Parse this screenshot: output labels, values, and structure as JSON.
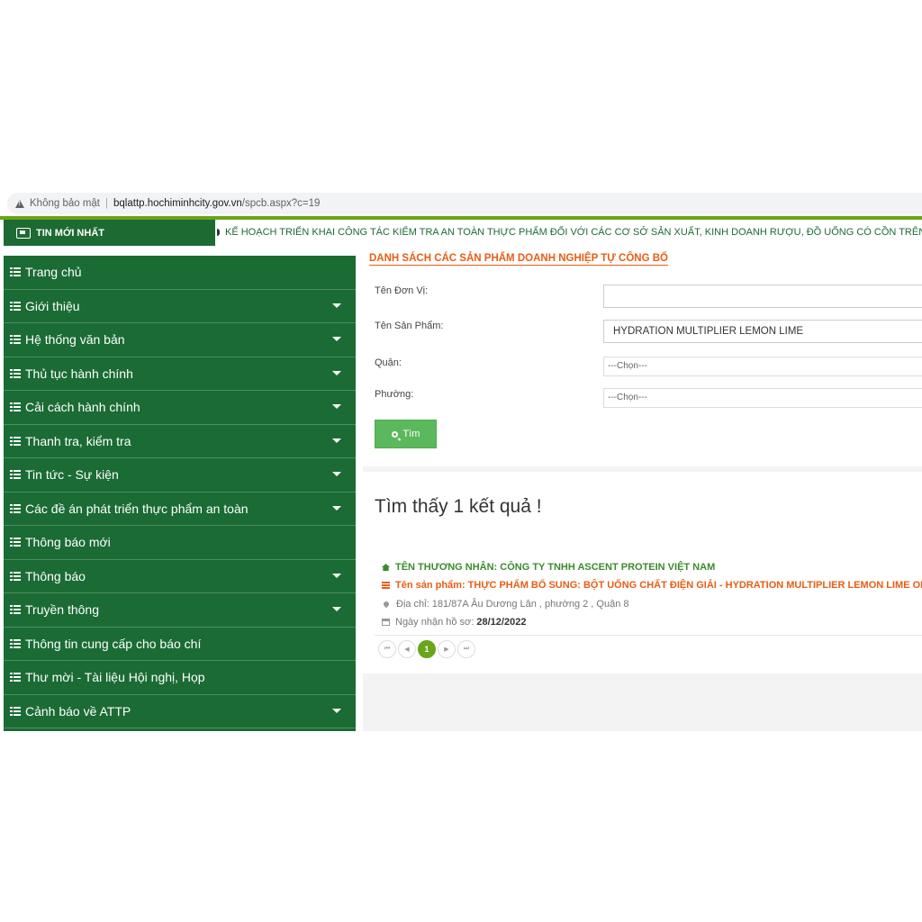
{
  "browser": {
    "security_label": "Không bảo mật",
    "url_host": "bqlattp.hochiminhcity.gov.vn",
    "url_path": "/spcb.aspx?c=19"
  },
  "ticker": {
    "label": "TIN MỚI NHẤT",
    "text": "KẾ HOẠCH TRIỂN KHAI CÔNG TÁC KIỂM TRA AN TOÀN THỰC PHẨM ĐỐI VỚI CÁC CƠ SỞ SẢN XUẤT, KINH DOANH RƯỢU, ĐỒ UỐNG CÓ CỒN TRÊN ĐỊA BÀN T"
  },
  "sidebar": {
    "items": [
      {
        "label": "Trang chủ",
        "has_caret": false
      },
      {
        "label": "Giới thiệu",
        "has_caret": true
      },
      {
        "label": "Hệ thống văn bản",
        "has_caret": true
      },
      {
        "label": "Thủ tục hành chính",
        "has_caret": true
      },
      {
        "label": "Cải cách hành chính",
        "has_caret": true
      },
      {
        "label": "Thanh tra, kiểm tra",
        "has_caret": true
      },
      {
        "label": "Tin tức - Sự kiện",
        "has_caret": true
      },
      {
        "label": "Các đề án phát triển thực phẩm an toàn",
        "has_caret": true
      },
      {
        "label": "Thông báo mới",
        "has_caret": false
      },
      {
        "label": "Thông báo",
        "has_caret": true
      },
      {
        "label": "Truyền thông",
        "has_caret": true
      },
      {
        "label": "Thông tin cung cấp cho báo chí",
        "has_caret": false
      },
      {
        "label": "Thư mời - Tài liệu Hội nghị, Họp",
        "has_caret": false
      },
      {
        "label": "Cảnh báo về ATTP",
        "has_caret": true
      }
    ]
  },
  "search": {
    "title": "DANH SÁCH CÁC SẢN PHẨM DOANH NGHIỆP TỰ CÔNG BỐ",
    "unit_label": "Tên Đơn Vị:",
    "unit_value": "",
    "product_label": "Tên Sản Phẩm:",
    "product_value": "HYDRATION MULTIPLIER LEMON LIME",
    "district_label": "Quận:",
    "district_value": "---Chọn---",
    "ward_label": "Phường:",
    "ward_value": "---Chọn---",
    "search_button": "Tìm"
  },
  "results": {
    "heading": "Tìm thấy 1 kết quả !",
    "items": [
      {
        "merchant": "TÊN THƯƠNG NHÂN: CÔNG TY TNHH ASCENT PROTEIN VIỆT NAM",
        "product": "Tên sản phẩm: THỰC PHẨM BỔ SUNG: BỘT UỐNG CHẤT ĐIỆN GIẢI - HYDRATION MULTIPLIER LEMON LIME ONE-TIME",
        "address": "Địa chỉ: 181/87A Âu Dương Lân , phường 2 , Quận 8",
        "date_label": "Ngày nhận hồ sơ:",
        "date_value": "28/12/2022"
      }
    ],
    "pager": {
      "first": "⏮",
      "prev": "◀",
      "current": "1",
      "next": "▶",
      "last": "⏭"
    }
  },
  "colors": {
    "brand_green": "#1b6b35",
    "accent_orange": "#e85d14",
    "button_green": "#5cb85c",
    "pager_active": "#6aa51a"
  }
}
